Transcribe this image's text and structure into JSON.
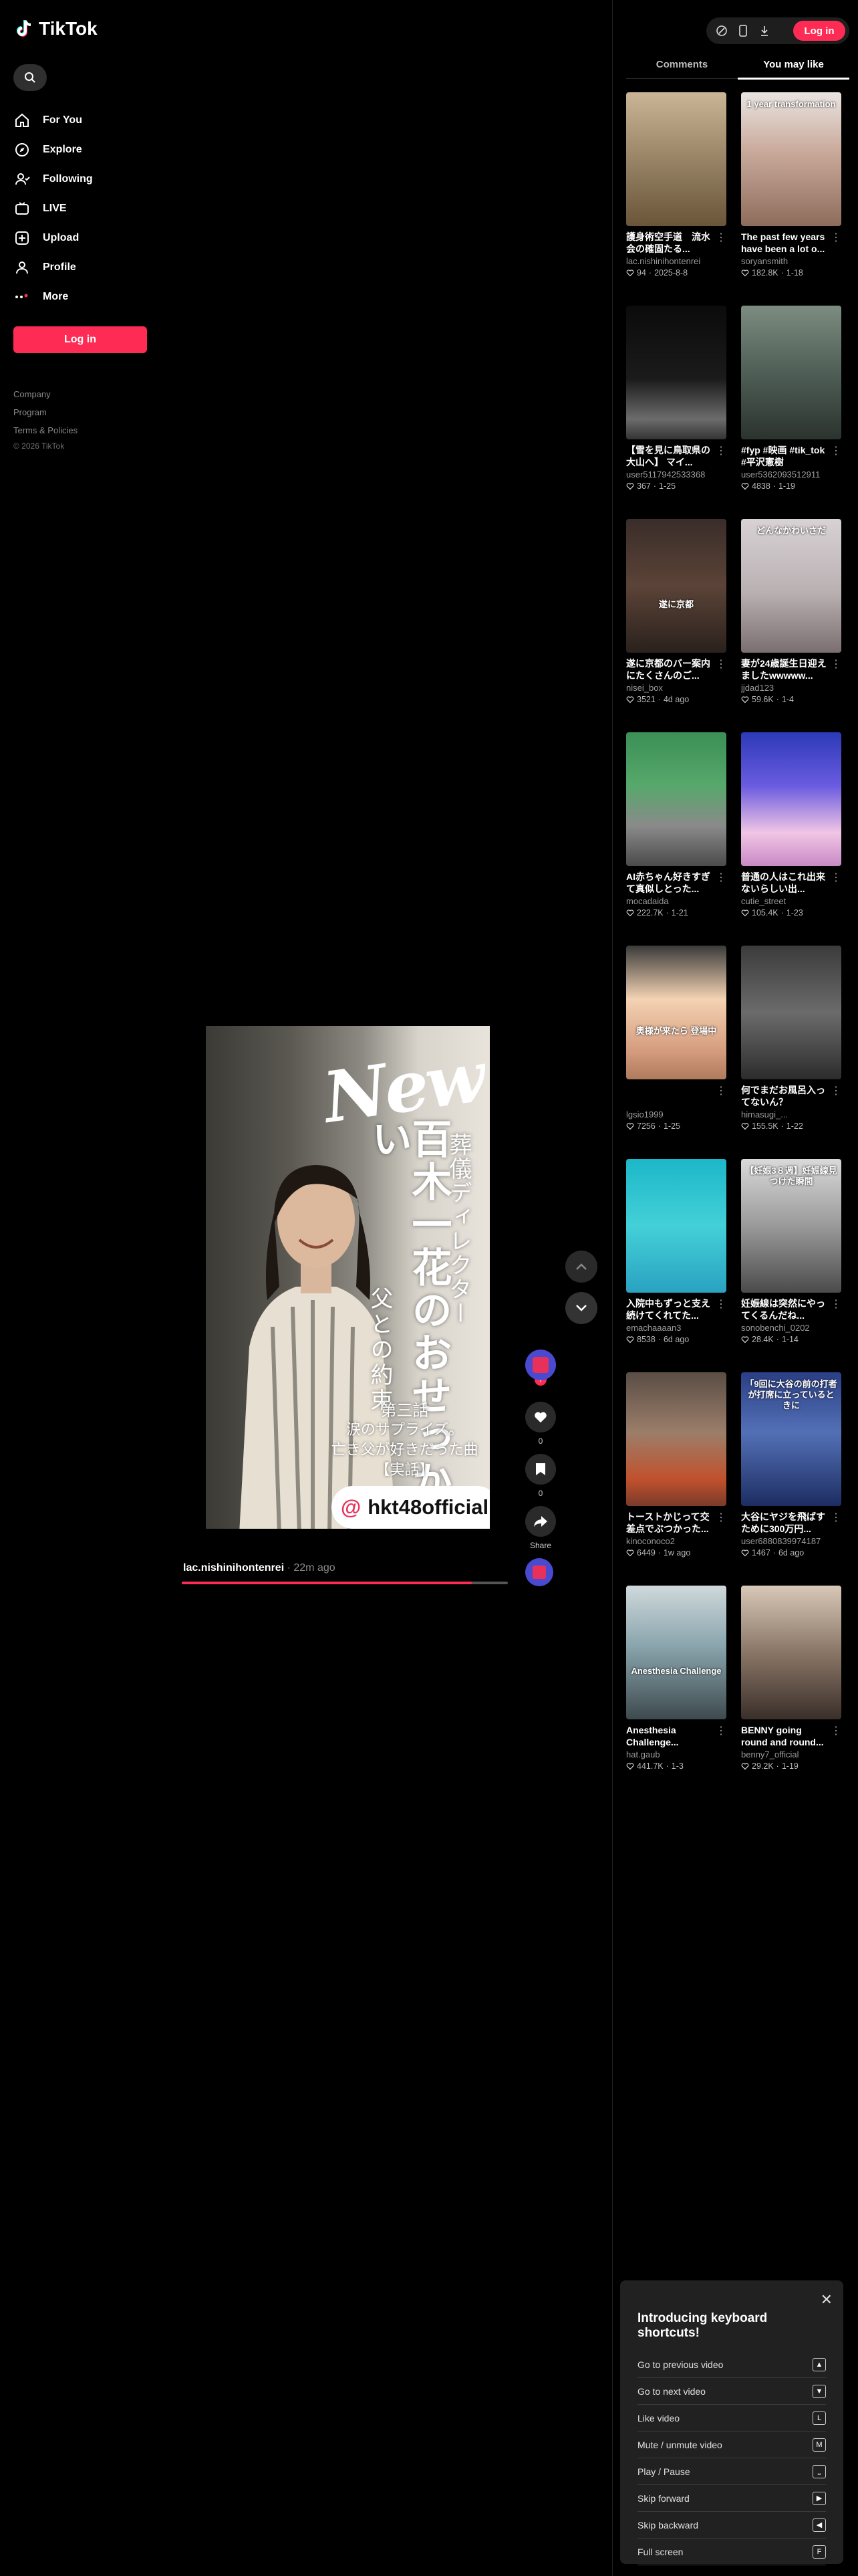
{
  "app": {
    "name": "TikTok",
    "brand_color": "#fe2c55"
  },
  "nav": {
    "items": [
      {
        "label": "For You",
        "icon": "home-icon"
      },
      {
        "label": "Explore",
        "icon": "compass-icon"
      },
      {
        "label": "Following",
        "icon": "following-icon"
      },
      {
        "label": "LIVE",
        "icon": "live-icon"
      },
      {
        "label": "Upload",
        "icon": "upload-icon"
      },
      {
        "label": "Profile",
        "icon": "profile-icon"
      },
      {
        "label": "More",
        "icon": "more-icon"
      }
    ],
    "login": "Log in"
  },
  "footer": {
    "company": "Company",
    "program": "Program",
    "terms": "Terms & Policies",
    "copyright": "© 2026 TikTok"
  },
  "video": {
    "new_text": "New",
    "vertical_small": "葬儀ディレクター",
    "vertical_title": "百木一花のおせっかい",
    "vertical_sub": "父との約束",
    "episode": "第三話",
    "episode_line1": "涙のサプライズ。",
    "episode_line2": "亡き父が好きだった曲【実話】",
    "badge_text": "hkt48official",
    "author": "lac.nishinihontenrei",
    "time": "22m ago",
    "progress": 0.89,
    "like_count": "0",
    "save_count": "0",
    "share_label": "Share"
  },
  "header": {
    "login": "Log in"
  },
  "tabs": {
    "comments": "Comments",
    "you_may_like": "You may like"
  },
  "recommendations": [
    {
      "title": "護身術空手道　流水会の確固たる...",
      "author": "lac.nishinihontenrei",
      "likes": "94",
      "date": "2025-8-8",
      "overlay": "",
      "bg": "linear-gradient(180deg,#cbb597 0%,#8e7a5c 60%,#6a5538 100%)"
    },
    {
      "title": "The past few years have been a lot o...",
      "author": "soryansmith",
      "likes": "182.8K",
      "date": "1-18",
      "overlay": "1 year transformation",
      "bg": "linear-gradient(180deg,#e9e4e1 0%,#c9a99a 45%,#8d6c5c 100%)"
    },
    {
      "title": "【雪を見に鳥取県の大山へ】 マイ...",
      "author": "user5117942533368",
      "likes": "367",
      "date": "1-25",
      "overlay": "",
      "bg": "linear-gradient(180deg,#0b0b0b 0%,#1b1b1b 55%,#6c6c6c 85%,#333 100%)"
    },
    {
      "title": "#fyp #映画 #tik_tok #平沢憲樹",
      "author": "user5362093512911",
      "likes": "4838",
      "date": "1-19",
      "overlay": "",
      "bg": "linear-gradient(180deg,#7d8c80 0%,#4b5a52 55%,#2b332e 100%)"
    },
    {
      "title": "遂に京都のバー案内にたくさんのご...",
      "author": "nisei_box",
      "likes": "3521",
      "date": "4d ago",
      "overlay": "遂に京都",
      "bg": "linear-gradient(180deg,#3a2d2a 0%,#5b4337 50%,#2a211d 100%)"
    },
    {
      "title": "妻が24歳誕生日迎えましたwwwww...",
      "author": "jjdad123",
      "likes": "59.6K",
      "date": "1-4",
      "overlay": "どんなかわいさだ",
      "bg": "linear-gradient(180deg,#d8d2d4 0%,#b9b0b2 55%,#7a6e70 100%)"
    },
    {
      "title": "AI赤ちゃん好きすぎて真似しとった...",
      "author": "mocadaida",
      "likes": "222.7K",
      "date": "1-21",
      "overlay": "",
      "bg": "linear-gradient(180deg,#3c8f55 0%,#56a86b 40%,#8a8a8a 70%,#4b4b4b 100%)"
    },
    {
      "title": "普通の人はこれ出来ないらしい出...",
      "author": "cutie_street",
      "likes": "105.4K",
      "date": "1-23",
      "overlay": "",
      "bg": "linear-gradient(180deg,#2c3ab8 0%,#6a5be0 40%,#f0c5e4 75%,#c98ac6 100%)"
    },
    {
      "title": "",
      "author": "lgsio1999",
      "likes": "7256",
      "date": "1-25",
      "overlay": "奥様が来たら 登場中",
      "bg": "linear-gradient(180deg,#3a3a3a 0%,#f4d3b3 40%,#d39a7c 80%,#b07a5c 100%)"
    },
    {
      "title": "何でまだお風呂入ってないん？",
      "author": "himasugi_...",
      "likes": "155.5K",
      "date": "1-22",
      "overlay": "",
      "bg": "linear-gradient(180deg,#3b3b3b 0%,#6b6b6b 50%,#2c2c2c 100%)"
    },
    {
      "title": "入院中もずっと支え続けてくれてた...",
      "author": "emachaaaan3",
      "likes": "8538",
      "date": "6d ago",
      "overlay": "",
      "bg": "linear-gradient(180deg,#1cb7c9 0%,#43d0d8 50%,#2aa2c1 100%)"
    },
    {
      "title": "妊娠線は突然にやってくるんだね...",
      "author": "sonobenchi_0202",
      "likes": "28.4K",
      "date": "1-14",
      "overlay": "【妊娠3８週】妊娠線見つけた瞬間",
      "bg": "linear-gradient(180deg,#d9d9d9 0%,#9a9a9a 50%,#4b4b4b 100%)"
    },
    {
      "title": "トーストかじって交差点でぶつかった...",
      "author": "kinoconoco2",
      "likes": "6449",
      "date": "1w ago",
      "overlay": "",
      "bg": "linear-gradient(180deg,#5a4d45 0%,#9b7e6a 45%,#c1512d 80%,#7a3b2a 100%)"
    },
    {
      "title": "大谷にヤジを飛ばすために300万円...",
      "author": "user6880839974187",
      "likes": "1467",
      "date": "6d ago",
      "overlay": "「9回に大谷の前の打者が打席に立っているときに",
      "bg": "linear-gradient(180deg,#2a3f85 0%,#5370b6 45%,#1d2d62 100%)"
    },
    {
      "title": "Anesthesia Challenge...",
      "author": "hat.gaub",
      "likes": "441.7K",
      "date": "1-3",
      "overlay": "Anesthesia Challenge",
      "bg": "linear-gradient(180deg,#cfd9dc 0%,#8aa5ad 45%,#3d4a4e 100%)"
    },
    {
      "title": "BENNY going round and round...",
      "author": "benny7_official",
      "likes": "29.2K",
      "date": "1-19",
      "overlay": "",
      "bg": "linear-gradient(180deg,#d8c8b8 0%,#8a7666 50%,#3a2f2a 100%)"
    }
  ],
  "shortcuts": {
    "title": "Introducing keyboard shortcuts!",
    "items": [
      {
        "label": "Go to previous video",
        "key": "▲"
      },
      {
        "label": "Go to next video",
        "key": "▼"
      },
      {
        "label": "Like video",
        "key": "L"
      },
      {
        "label": "Mute / unmute video",
        "key": "M"
      },
      {
        "label": "Play / Pause",
        "key": "⎵"
      },
      {
        "label": "Skip forward",
        "key": "▶"
      },
      {
        "label": "Skip backward",
        "key": "◀"
      },
      {
        "label": "Full screen",
        "key": "F"
      }
    ]
  }
}
